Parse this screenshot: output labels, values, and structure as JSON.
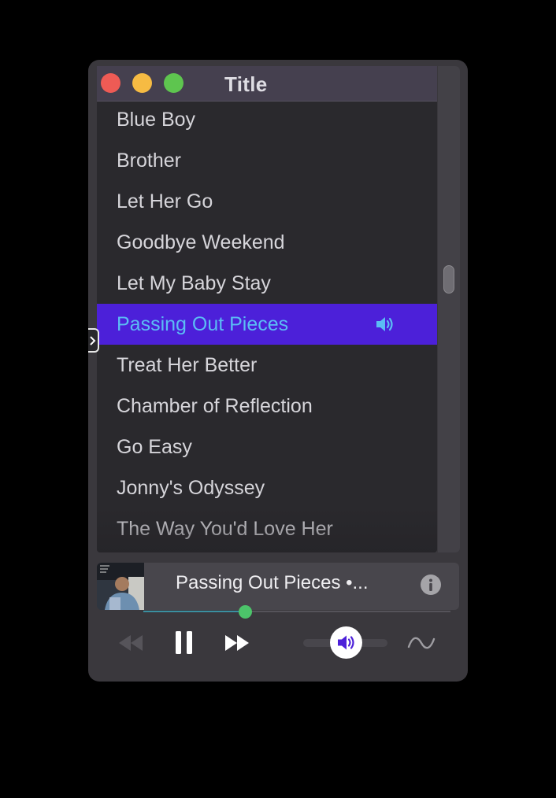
{
  "window": {
    "title": "Title"
  },
  "tracks": [
    {
      "title": "Blue Boy"
    },
    {
      "title": "Brother"
    },
    {
      "title": "Let Her Go"
    },
    {
      "title": "Goodbye Weekend"
    },
    {
      "title": "Let My Baby Stay"
    },
    {
      "title": "Passing Out Pieces",
      "playing": true
    },
    {
      "title": "Treat Her Better"
    },
    {
      "title": "Chamber of Reflection"
    },
    {
      "title": "Go Easy"
    },
    {
      "title": "Jonny's Odyssey"
    },
    {
      "title": "The Way You'd Love Her"
    }
  ],
  "now_playing": {
    "title": "Passing Out Pieces",
    "suffix": " •...",
    "progress_fraction": 0.33
  },
  "volume": {
    "level_fraction": 0.5
  },
  "colors": {
    "accent": "#4c20d9",
    "active_text": "#5bbdf4",
    "progress_knob": "#4cc46a",
    "close": "#ee5b55",
    "minimize": "#f6bb43",
    "maximize": "#5ec54f"
  },
  "icons": {
    "close": "close-button",
    "minimize": "minimize-button",
    "maximize": "maximize-button",
    "now_playing": "speaker-icon",
    "info": "info-icon",
    "prev": "rewind-icon",
    "pause": "pause-icon",
    "next": "fast-forward-icon",
    "volume": "speaker-icon",
    "visualizer": "wave-icon"
  }
}
